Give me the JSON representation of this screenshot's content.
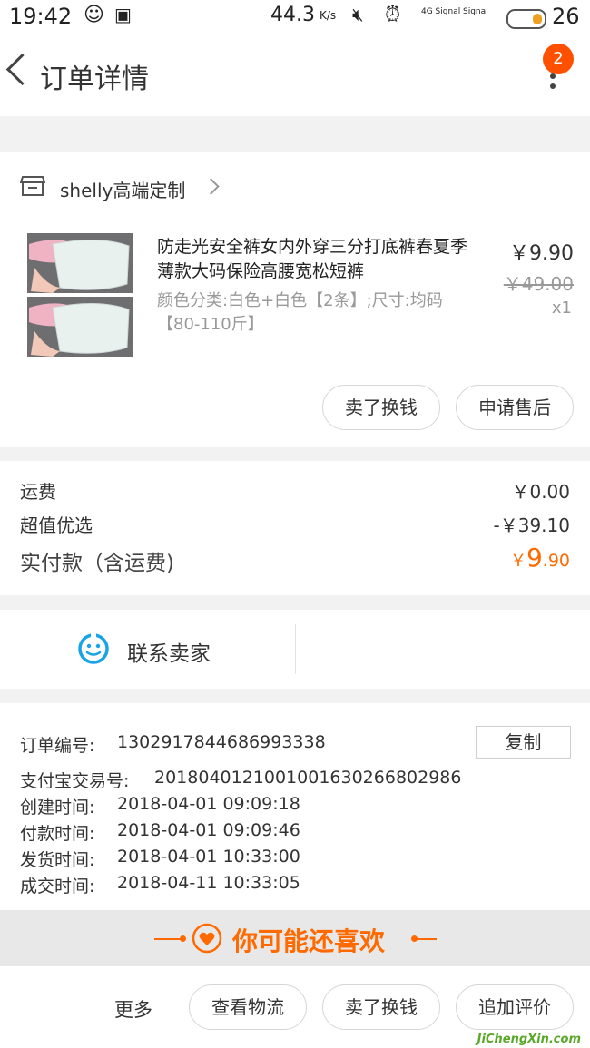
{
  "status_bar": {
    "time": "19:42",
    "speed": "44.3",
    "speed_unit": "K/s",
    "net1": "4G Signal",
    "net2": "Signal",
    "battery": "26"
  },
  "header": {
    "title": "订单详情",
    "badge_count": "2"
  },
  "shop": {
    "name": "shelly高端定制"
  },
  "product": {
    "title": "防走光安全裤女内外穿三分打底裤春夏季薄款大码保险高腰宽松短裤",
    "spec": "颜色分类:白色+白色【2条】;尺寸:均码【80-110斤】",
    "price": "￥9.90",
    "original_price": "￥49.00",
    "quantity": "x1"
  },
  "product_actions": {
    "sell": "卖了换钱",
    "after_sale": "申请售后"
  },
  "summary": {
    "shipping_label": "运费",
    "shipping_value": "￥0.00",
    "discount_label": "超值优选",
    "discount_value": "-￥39.10",
    "paid_label": "实付款（含运费)",
    "paid_currency": "￥",
    "paid_int": "9",
    "paid_dec": ".90"
  },
  "contact": {
    "label": "联系卖家"
  },
  "order_info": {
    "order_no_label": "订单编号:",
    "order_no": "1302917844686993338",
    "copy": "复制",
    "alipay_label": "支付宝交易号:",
    "alipay_no": "2018040121001001630266802986",
    "created_label": "创建时间:",
    "created": "2018-04-01 09:09:18",
    "paid_label": "付款时间:",
    "paid": "2018-04-01 09:09:46",
    "shipped_label": "发货时间:",
    "shipped": "2018-04-01 10:33:00",
    "done_label": "成交时间:",
    "done": "2018-04-11 10:33:05"
  },
  "recommend": {
    "label": "你可能还喜欢"
  },
  "bottom_bar": {
    "more": "更多",
    "logistics": "查看物流",
    "sell": "卖了换钱",
    "review": "追加评价"
  },
  "watermark": "JiChengXin.com",
  "colors": {
    "accent": "#ff6a00",
    "badge": "#ff5000",
    "contact_icon": "#1aa3e8"
  }
}
